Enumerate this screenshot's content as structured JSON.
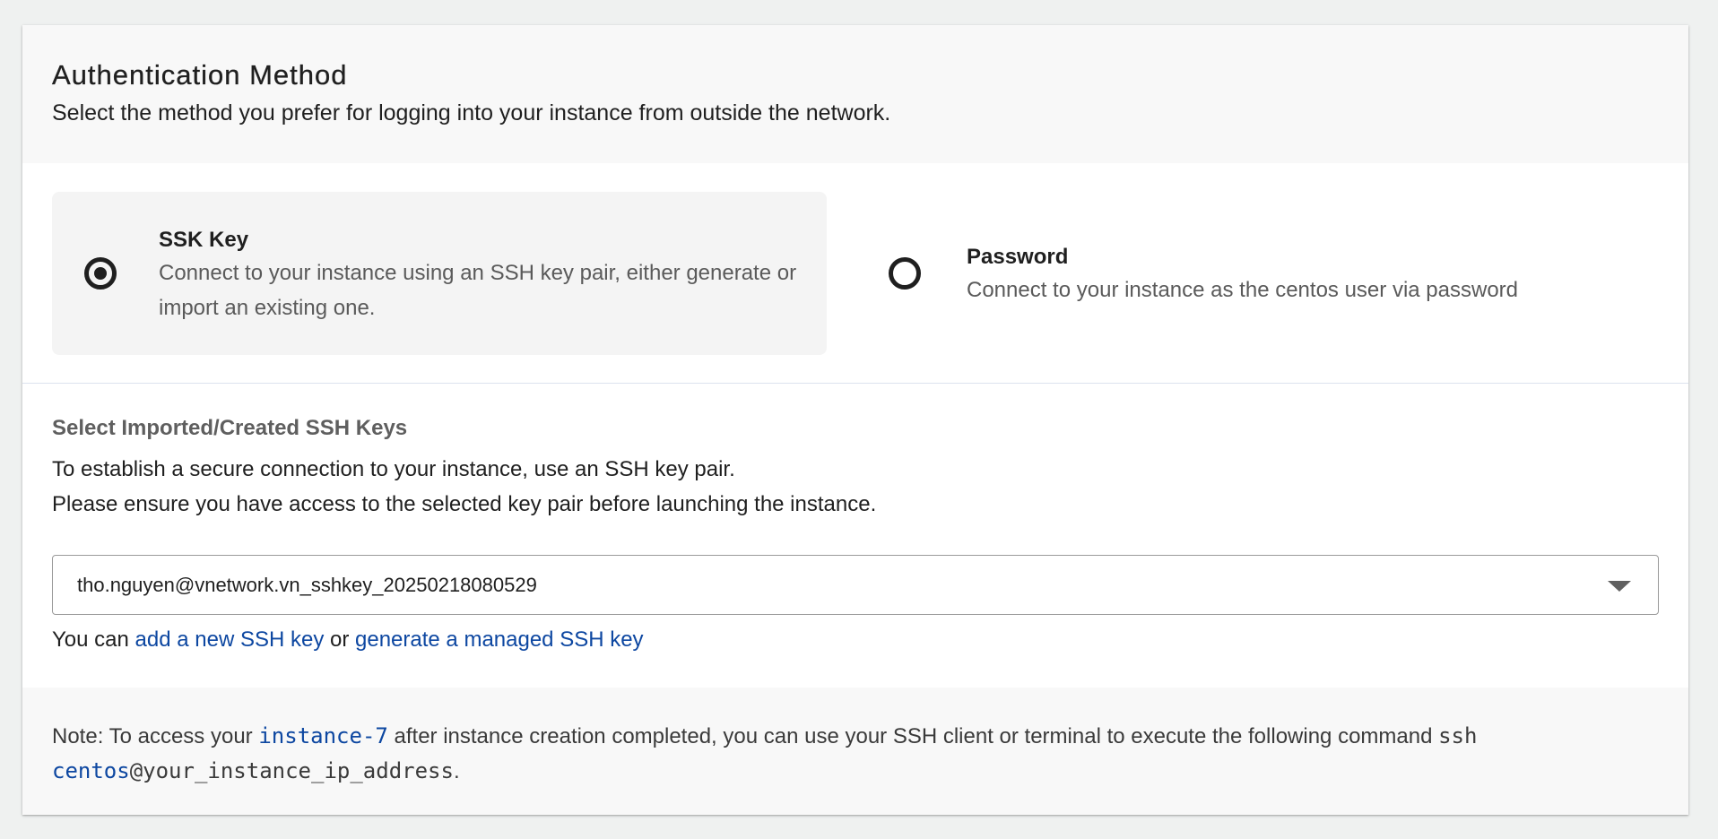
{
  "auth": {
    "title": "Authentication Method",
    "subtitle": "Select the method you prefer for logging into your instance from outside the network."
  },
  "options": {
    "ssh": {
      "title": "SSK Key",
      "description": "Connect to your instance using an SSH key pair, either generate or import an existing one.",
      "selected": true
    },
    "password": {
      "title": "Password",
      "description": "Connect to your instance as the centos user via password",
      "selected": false
    }
  },
  "ssh_keys": {
    "title": "Select Imported/Created SSH Keys",
    "desc_line1": "To establish a secure connection to your instance, use an SSH key pair.",
    "desc_line2": "Please ensure you have access to the selected key pair before launching the instance.",
    "selected_key": "tho.nguyen@vnetwork.vn_sshkey_20250218080529",
    "links": {
      "prefix": "You can ",
      "add_link": "add a new SSH key",
      "or_text": " or ",
      "generate_link": "generate a managed SSH key"
    }
  },
  "note": {
    "prefix": "Note: To access your ",
    "instance_name": "instance-7",
    "middle": " after instance creation completed, you can use your SSH client or terminal to execute the following command ",
    "cmd_ssh": "ssh",
    "cmd_user": "centos",
    "cmd_host": "@your_instance_ip_address",
    "suffix": "."
  },
  "colors": {
    "link": "#0d47a1",
    "background": "#eff1f0",
    "selected_option_bg": "#f4f4f4"
  },
  "icons": {
    "dropdown": "chevron-down-icon",
    "radio_selected": "radio-checked-icon",
    "radio_unselected": "radio-unchecked-icon"
  }
}
